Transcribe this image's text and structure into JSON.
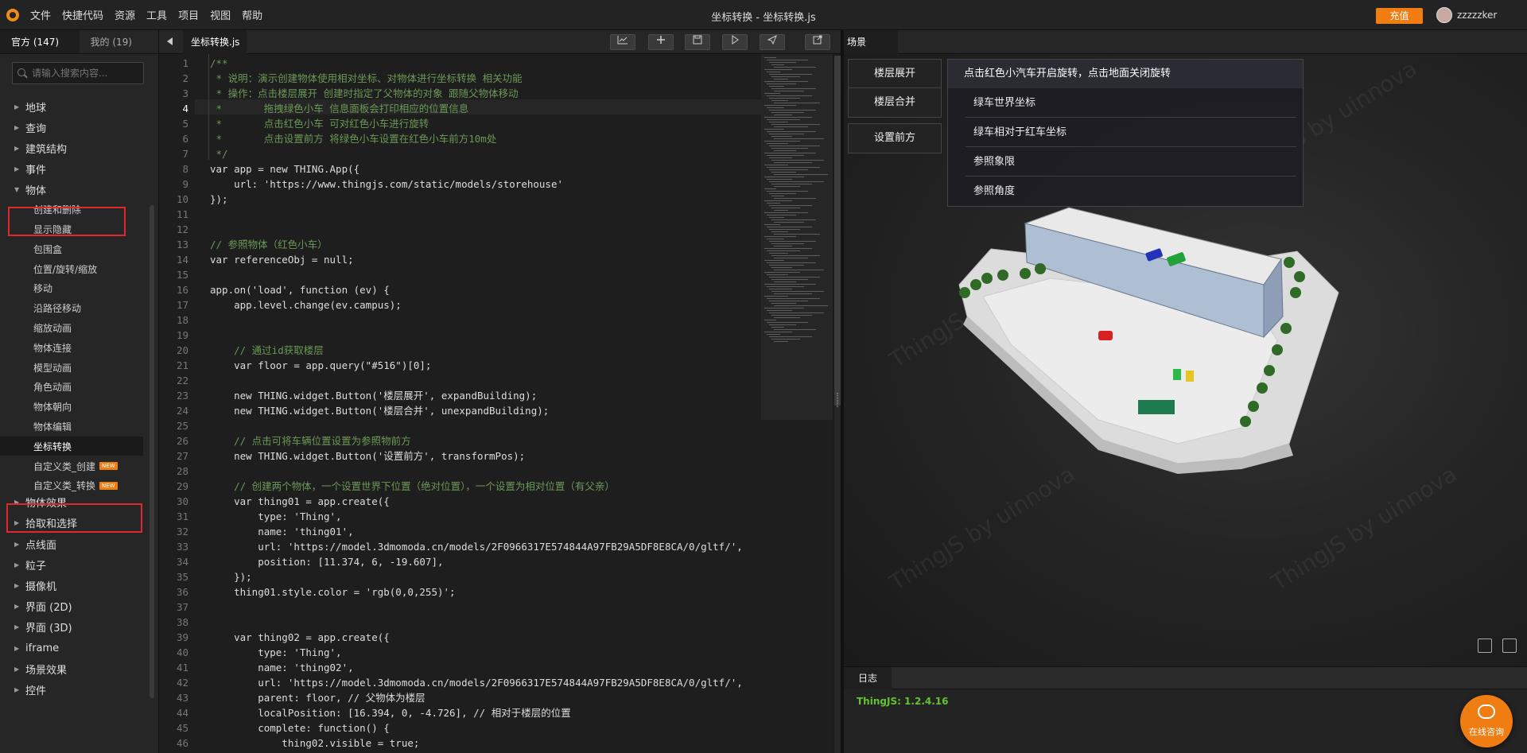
{
  "menubar": {
    "items": [
      "文件",
      "快捷代码",
      "资源",
      "工具",
      "项目",
      "视图",
      "帮助"
    ],
    "title": "坐标转换 -  坐标转换.js",
    "recharge": "充值",
    "username": "zzzzzker"
  },
  "sidebar": {
    "tabs": [
      "官方 (147)",
      "我的 (19)"
    ],
    "search_placeholder": "请输入搜索内容...",
    "top_items": [
      "地球",
      "查询",
      "建筑结构",
      "事件"
    ],
    "expanded": "物体",
    "sub_items": [
      "创建和删除",
      "显示隐藏",
      "包围盒",
      "位置/旋转/缩放",
      "移动",
      "沿路径移动",
      "缩放动画",
      "物体连接",
      "模型动画",
      "角色动画",
      "物体朝向",
      "物体编辑",
      "坐标转换",
      "自定义类_创建",
      "自定义类_转换"
    ],
    "active_sub": "坐标转换",
    "new_badge": "NEW",
    "bottom_items": [
      "物体效果",
      "拾取和选择",
      "点线面",
      "粒子",
      "摄像机",
      "界面 (2D)",
      "界面 (3D)",
      "iframe",
      "场景效果",
      "控件"
    ]
  },
  "editor": {
    "file_tab": "坐标转换.js",
    "toolbar": [
      "chart-icon",
      "plus-icon",
      "save-icon",
      "play-icon",
      "send-icon",
      "share-icon"
    ],
    "current_line": 4,
    "lines": [
      "/**",
      " * 说明：演示创建物体使用相对坐标、对物体进行坐标转换 相关功能",
      " * 操作：点击楼层展开 创建时指定了父物体的对象 跟随父物体移动",
      " *       拖拽绿色小车 信息面板会打印相应的位置信息",
      " *       点击红色小车 可对红色小车进行旋转",
      " *       点击设置前方 将绿色小车设置在红色小车前方10m处",
      " */",
      "var app = new THING.App({",
      "    url: 'https://www.thingjs.com/static/models/storehouse'",
      "});",
      "",
      "",
      "// 参照物体（红色小车）",
      "var referenceObj = null;",
      "",
      "app.on('load', function (ev) {",
      "    app.level.change(ev.campus);",
      "",
      "",
      "    // 通过id获取楼层",
      "    var floor = app.query(\"#516\")[0];",
      "",
      "    new THING.widget.Button('楼层展开', expandBuilding);",
      "    new THING.widget.Button('楼层合并', unexpandBuilding);",
      "",
      "    // 点击可将车辆位置设置为参照物前方",
      "    new THING.widget.Button('设置前方', transformPos);",
      "",
      "    // 创建两个物体，一个设置世界下位置（绝对位置），一个设置为相对位置（有父亲）",
      "    var thing01 = app.create({",
      "        type: 'Thing',",
      "        name: 'thing01',",
      "        url: 'https://model.3dmomoda.cn/models/2F0966317E574844A97FB29A5DF8E8CA/0/gltf/',",
      "        position: [11.374, 6, -19.607],",
      "    });",
      "    thing01.style.color = 'rgb(0,0,255)';",
      "",
      "",
      "    var thing02 = app.create({",
      "        type: 'Thing',",
      "        name: 'thing02',",
      "        url: 'https://model.3dmomoda.cn/models/2F0966317E574844A97FB29A5DF8E8CA/0/gltf/',",
      "        parent: floor, // 父物体为楼层",
      "        localPosition: [16.394, 0, -4.726], // 相对于楼层的位置",
      "        complete: function() {",
      "            thing02.visible = true;"
    ]
  },
  "scene": {
    "tab": "场景",
    "buttons": [
      "楼层展开",
      "楼层合并",
      "设置前方"
    ],
    "info_title": "点击红色小汽车开启旋转，点击地面关闭旋转",
    "info_rows": [
      "绿车世界坐标",
      "绿车相对于红车坐标",
      "参照象限",
      "参照角度"
    ],
    "watermark": "ThingJS by uinnova"
  },
  "log": {
    "tab": "日志",
    "line": "ThingJS: 1.2.4.16"
  },
  "chat": {
    "label": "在线咨询"
  },
  "colors": {
    "accent": "#f07d11",
    "highlight": "#e0282b",
    "log_green": "#64c232"
  }
}
